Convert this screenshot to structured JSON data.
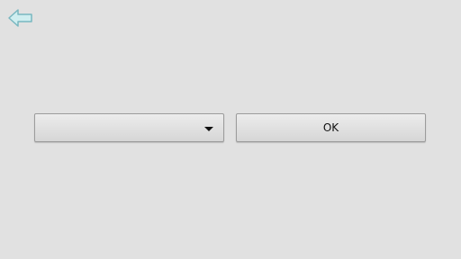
{
  "back_button": {
    "icon": "back-arrow-icon",
    "color": "#cfeef0",
    "stroke": "#79b7c0"
  },
  "dropdown": {
    "selected_value": "",
    "icon": "chevron-down-icon"
  },
  "ok_button": {
    "label": "OK"
  },
  "colors": {
    "background": "#e1e1e1",
    "button_top": "#ececec",
    "button_bottom": "#d6d6d6",
    "button_border": "#9c9c9c"
  }
}
